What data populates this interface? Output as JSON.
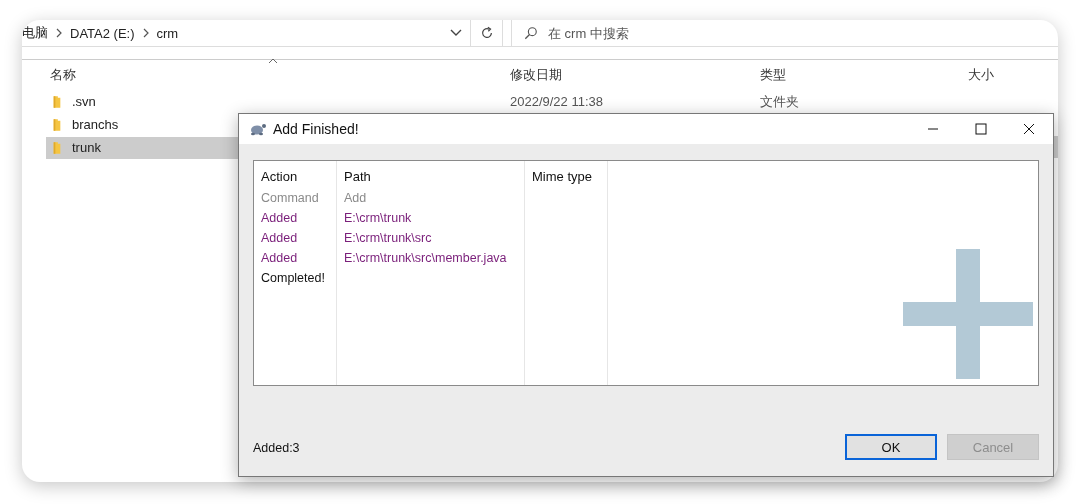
{
  "explorer": {
    "breadcrumb": [
      "电脑",
      "DATA2 (E:)",
      "crm"
    ],
    "search": {
      "placeholder": "在 crm 中搜索"
    },
    "columns": [
      "名称",
      "修改日期",
      "类型",
      "大小"
    ],
    "rows": [
      {
        "name": ".svn",
        "date": "2022/9/22 11:38",
        "type": "文件夹",
        "selected": false
      },
      {
        "name": "branchs",
        "selected": false
      },
      {
        "name": "trunk",
        "selected": true
      }
    ]
  },
  "dialog": {
    "title": "Add Finished!",
    "columns": [
      "Action",
      "Path",
      "Mime type"
    ],
    "rows": [
      {
        "kind": "command",
        "action": "Command",
        "path": "Add"
      },
      {
        "kind": "added",
        "action": "Added",
        "path": "E:\\crm\\trunk"
      },
      {
        "kind": "added",
        "action": "Added",
        "path": "E:\\crm\\trunk\\src"
      },
      {
        "kind": "added",
        "action": "Added",
        "path": "E:\\crm\\trunk\\src\\member.java"
      },
      {
        "kind": "completed",
        "action": "Completed!"
      }
    ],
    "summary": "Added:3",
    "buttons": [
      {
        "label": "OK",
        "disabled": false,
        "focused": true
      },
      {
        "label": "Cancel",
        "disabled": true,
        "focused": false
      }
    ]
  }
}
